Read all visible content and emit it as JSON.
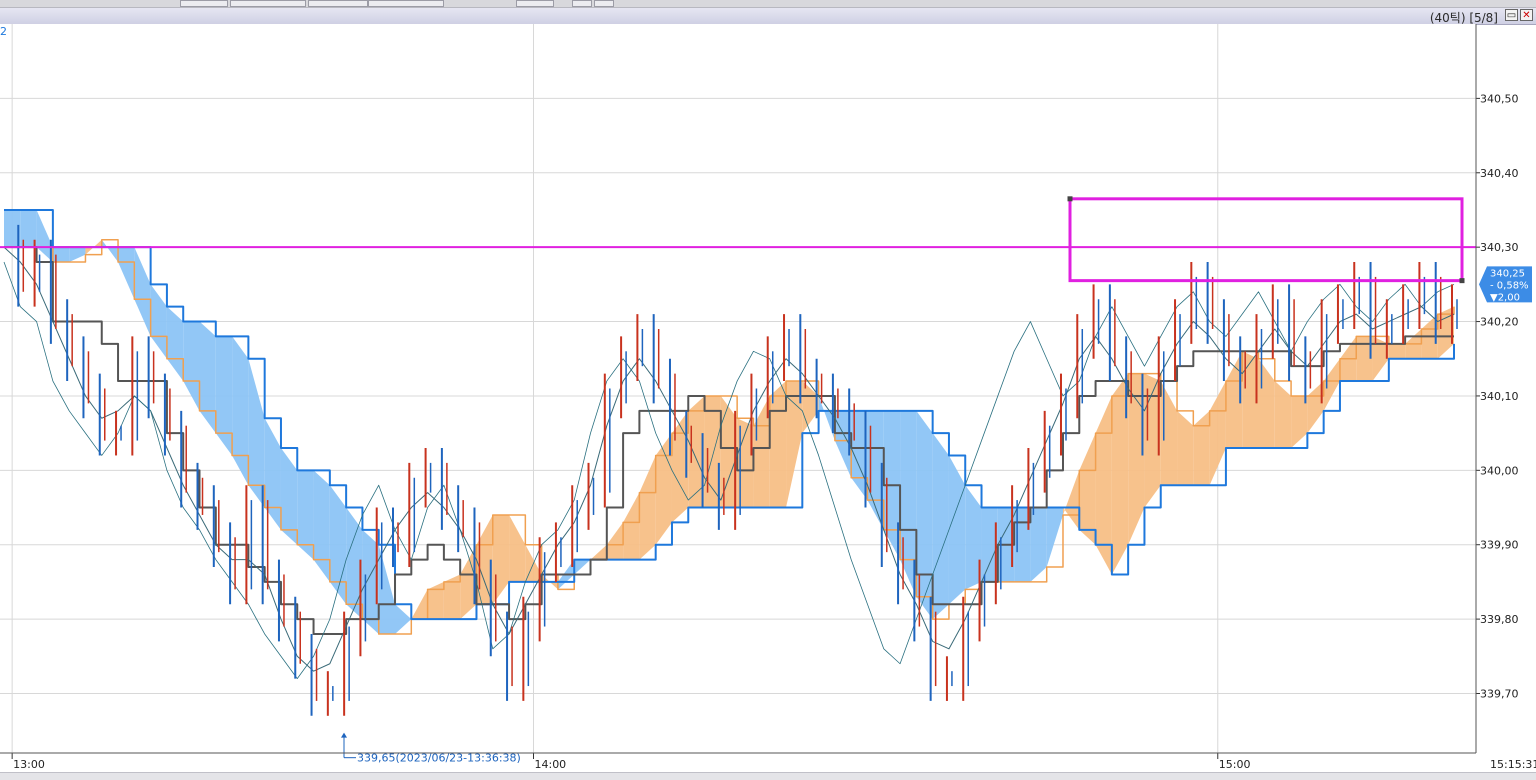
{
  "window": {
    "title": "(40틱) [5/8]",
    "buttons": [
      "restore",
      "close"
    ]
  },
  "colors": {
    "up": "#c8321e",
    "down": "#1e64be",
    "cloud_bull": "#f7bf86",
    "cloud_bear": "#8cc4f6",
    "span_a": "#f0a050",
    "span_b": "#1e78dc",
    "base_line": "#555555",
    "lagging": "#2a7080",
    "drawing": "#e020e0",
    "current_price_bg": "#3c8ce6"
  },
  "chart_data": {
    "type": "line",
    "symbol_tag": "2",
    "x_tick_labels": [
      "13:00",
      "14:00",
      "15:00"
    ],
    "last_time_label": "15:15:31",
    "y_tick_labels": [
      "340,50",
      "340,40",
      "340,30",
      "340,20",
      "340,10",
      "340,00",
      "339,90",
      "339,80",
      "339,70"
    ],
    "ylim": [
      339.62,
      340.6
    ],
    "y_ticks": [
      340.5,
      340.4,
      340.3,
      340.2,
      340.1,
      340.0,
      339.9,
      339.8,
      339.7
    ],
    "current_price": {
      "price": "340,25",
      "change_pct": "- 0,58%",
      "change": "▼2,00",
      "value": 340.25
    },
    "low_annotation": {
      "text": "339,65(2023/06/23-13:36:38)",
      "value": 339.65
    },
    "horizontal_line": 340.3,
    "highlight_box": {
      "y_top": 340.365,
      "y_bottom": 340.255
    },
    "series": [
      {
        "name": "",
        "role": "price",
        "values": [
          340.3,
          340.25,
          340.28,
          340.2,
          340.15,
          340.1,
          340.05,
          340.05,
          340.15,
          340.1,
          340.05,
          339.98,
          339.95,
          339.9,
          339.85,
          339.95,
          339.85,
          339.8,
          339.75,
          339.7,
          339.7,
          339.78,
          339.85,
          339.92,
          339.9,
          339.98,
          340.0,
          339.95,
          339.92,
          339.85,
          339.78,
          339.72,
          339.8,
          339.88,
          339.9,
          339.95,
          339.98,
          340.1,
          340.15,
          340.18,
          340.12,
          340.05,
          340.02,
          339.98,
          339.95,
          340.05,
          340.1,
          340.15,
          340.18,
          340.12,
          340.1,
          340.08,
          340.05,
          339.98,
          339.9,
          339.85,
          339.8,
          339.72,
          339.72,
          339.8,
          339.85,
          339.9,
          339.95,
          340.0,
          340.05,
          340.1,
          340.18,
          340.22,
          340.15,
          340.1,
          340.05,
          340.15,
          340.2,
          340.25,
          340.2,
          340.15,
          340.12,
          340.18,
          340.22,
          340.15,
          340.12,
          340.2,
          340.22,
          340.25,
          340.18,
          340.2,
          340.22,
          340.25,
          340.2,
          340.22
        ]
      },
      {
        "name": "",
        "role": "conversion",
        "values": [
          340.3,
          340.28,
          340.25,
          340.2,
          340.15,
          340.1,
          340.07,
          340.08,
          340.1,
          340.08,
          340.03,
          339.98,
          339.94,
          339.9,
          339.88,
          339.88,
          339.86,
          339.8,
          339.75,
          339.73,
          339.74,
          339.79,
          339.84,
          339.88,
          339.92,
          339.95,
          339.97,
          339.95,
          339.92,
          339.88,
          339.82,
          339.78,
          339.82,
          339.86,
          339.9,
          339.93,
          339.98,
          340.06,
          340.12,
          340.15,
          340.12,
          340.08,
          340.04,
          339.99,
          339.96,
          340.02,
          340.08,
          340.12,
          340.15,
          340.13,
          340.1,
          340.07,
          340.03,
          339.98,
          339.92,
          339.86,
          339.82,
          339.77,
          339.76,
          339.8,
          339.85,
          339.9,
          339.94,
          339.99,
          340.04,
          340.09,
          340.15,
          340.18,
          340.15,
          340.11,
          340.08,
          340.13,
          340.17,
          340.2,
          340.18,
          340.15,
          340.13,
          340.16,
          340.19,
          340.16,
          340.14,
          340.17,
          340.2,
          340.21,
          340.19,
          340.2,
          340.21,
          340.22,
          340.2,
          340.21
        ]
      },
      {
        "name": "",
        "role": "base",
        "values": [
          340.3,
          340.3,
          340.28,
          340.2,
          340.2,
          340.2,
          340.17,
          340.12,
          340.12,
          340.12,
          340.05,
          340.0,
          339.95,
          339.9,
          339.9,
          339.87,
          339.85,
          339.82,
          339.8,
          339.78,
          339.78,
          339.8,
          339.8,
          339.82,
          339.86,
          339.88,
          339.9,
          339.88,
          339.86,
          339.82,
          339.82,
          339.8,
          339.82,
          339.86,
          339.86,
          339.86,
          339.88,
          339.95,
          340.05,
          340.08,
          340.08,
          340.08,
          340.1,
          340.08,
          340.03,
          340.0,
          340.03,
          340.08,
          340.1,
          340.1,
          340.1,
          340.05,
          340.03,
          340.03,
          339.98,
          339.92,
          339.86,
          339.82,
          339.82,
          339.82,
          339.85,
          339.9,
          339.93,
          339.95,
          340.0,
          340.05,
          340.1,
          340.12,
          340.12,
          340.1,
          340.1,
          340.12,
          340.14,
          340.16,
          340.16,
          340.16,
          340.16,
          340.16,
          340.16,
          340.14,
          340.14,
          340.16,
          340.17,
          340.17,
          340.17,
          340.17,
          340.18,
          340.18,
          340.18,
          340.18
        ]
      },
      {
        "name": "",
        "role": "span_a",
        "values": [
          340.3,
          340.3,
          340.3,
          340.28,
          340.28,
          340.29,
          340.31,
          340.28,
          340.23,
          340.18,
          340.15,
          340.12,
          340.08,
          340.05,
          340.02,
          339.98,
          339.95,
          339.92,
          339.9,
          339.88,
          339.85,
          339.82,
          339.8,
          339.78,
          339.78,
          339.8,
          339.84,
          339.85,
          339.86,
          339.9,
          339.94,
          339.94,
          339.9,
          339.86,
          339.84,
          339.86,
          339.88,
          339.9,
          339.93,
          339.97,
          340.02,
          340.05,
          340.08,
          340.1,
          340.1,
          340.07,
          340.06,
          340.1,
          340.12,
          340.12,
          340.1,
          340.04,
          339.99,
          339.96,
          339.92,
          339.88,
          339.83,
          339.8,
          339.82,
          339.84,
          339.85,
          339.85,
          339.85,
          339.85,
          339.87,
          339.94,
          340.0,
          340.05,
          340.1,
          340.13,
          340.13,
          340.12,
          340.08,
          340.06,
          340.08,
          340.12,
          340.16,
          340.15,
          340.12,
          340.1,
          340.1,
          340.12,
          340.15,
          340.18,
          340.18,
          340.17,
          340.17,
          340.19,
          340.21,
          340.22
        ]
      },
      {
        "name": "",
        "role": "span_b",
        "values": [
          340.35,
          340.35,
          340.35,
          340.3,
          340.3,
          340.3,
          340.3,
          340.3,
          340.3,
          340.25,
          340.22,
          340.2,
          340.2,
          340.18,
          340.18,
          340.15,
          340.07,
          340.03,
          340.0,
          340.0,
          339.98,
          339.95,
          339.92,
          339.9,
          339.82,
          339.8,
          339.8,
          339.8,
          339.8,
          339.82,
          339.82,
          339.85,
          339.85,
          339.85,
          339.85,
          339.88,
          339.88,
          339.88,
          339.88,
          339.88,
          339.9,
          339.93,
          339.95,
          339.95,
          339.95,
          339.95,
          339.95,
          339.95,
          339.95,
          340.05,
          340.08,
          340.08,
          340.08,
          340.08,
          340.08,
          340.08,
          340.08,
          340.05,
          340.02,
          339.98,
          339.95,
          339.95,
          339.95,
          339.95,
          339.95,
          339.95,
          339.92,
          339.9,
          339.86,
          339.9,
          339.95,
          339.98,
          339.98,
          339.98,
          339.98,
          340.03,
          340.03,
          340.03,
          340.03,
          340.03,
          340.05,
          340.08,
          340.12,
          340.12,
          340.12,
          340.15,
          340.15,
          340.15,
          340.15,
          340.17
        ]
      },
      {
        "name": "",
        "role": "lagging",
        "values": [
          340.28,
          340.22,
          340.2,
          340.12,
          340.08,
          340.05,
          340.02,
          340.05,
          340.1,
          340.08,
          340.0,
          339.95,
          339.92,
          339.88,
          339.85,
          339.82,
          339.78,
          339.75,
          339.72,
          339.75,
          339.8,
          339.88,
          339.94,
          339.98,
          339.92,
          339.88,
          339.95,
          339.98,
          339.92,
          339.85,
          339.76,
          339.78,
          339.85,
          339.9,
          339.92,
          339.96,
          340.05,
          340.12,
          340.15,
          340.12,
          340.05,
          340.0,
          339.96,
          339.98,
          340.06,
          340.12,
          340.16,
          340.15,
          340.1,
          340.08,
          340.02,
          339.95,
          339.88,
          339.82,
          339.76,
          339.74,
          339.8,
          339.86,
          339.92,
          339.98,
          340.04,
          340.1,
          340.16,
          340.2,
          340.15,
          340.1,
          340.12,
          340.18,
          340.22,
          340.18,
          340.14,
          340.18,
          340.22,
          340.24,
          340.2,
          340.18,
          340.21,
          340.24,
          340.2,
          340.16,
          340.2,
          340.23,
          340.25,
          340.22,
          340.2,
          340.23,
          340.25,
          340.22,
          340.24,
          340.25
        ]
      }
    ]
  }
}
